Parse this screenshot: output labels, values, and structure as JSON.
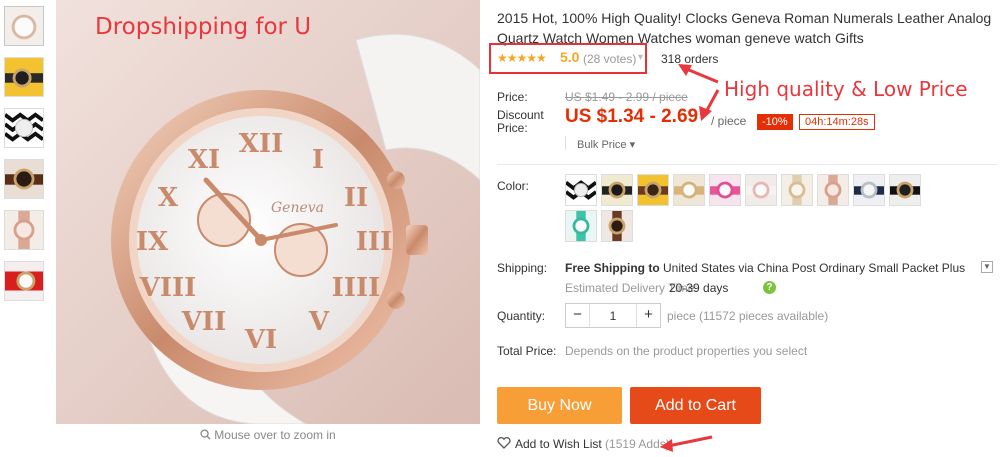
{
  "overlay": {
    "dropshipping": "Dropshipping for U"
  },
  "zoom_hint": "Mouse over to zoom in",
  "product": {
    "title": "2015 Hot, 100% High Quality! Clocks Geneva Roman Numerals Leather Analog Quartz Watch Women Watches woman geneve watch Gifts",
    "stars": "★★★★★",
    "rating": "5.0",
    "votes": "(28 votes)",
    "orders": "318 orders"
  },
  "annotations": {
    "high_quality": "High quality & Low Price"
  },
  "price": {
    "price_label": "Price:",
    "original": "US $1.49 - 2.99 / piece",
    "discount_label_1": "Discount",
    "discount_label_2": "Price:",
    "discount_price": "US $1.34 - 2.69",
    "per_piece": "/ piece",
    "badge": "-10%",
    "countdown": "04h:14m:28s",
    "bulk": "Bulk Price ▾"
  },
  "color": {
    "label": "Color:",
    "swatches": [
      "chevron-black-white",
      "black-gold",
      "brown-gold",
      "gold-white",
      "pink",
      "pink-white",
      "beige",
      "rose-gold",
      "navy",
      "black",
      "teal",
      "brown"
    ]
  },
  "shipping": {
    "label": "Shipping:",
    "free": "Free Shipping to",
    "dest": " United States via China Post Ordinary Small Packet Plus",
    "est_label": "Estimated Delivery Time:",
    "est_days": "20-39 days",
    "help": "?"
  },
  "quantity": {
    "label": "Quantity:",
    "value": "1",
    "minus": "−",
    "plus": "+",
    "note": "piece (11572 pieces available)"
  },
  "total": {
    "label": "Total Price:",
    "note": "Depends on the product properties you select"
  },
  "actions": {
    "buy_now": "Buy Now",
    "add_to_cart": "Add to Cart",
    "wish": "Add to Wish List",
    "wish_count": "(1519 Adds)"
  },
  "colors": {
    "accent_red": "#e62e04",
    "star": "#f5a623",
    "buy": "#f89e36",
    "cart": "#e64a19",
    "annot_red": "#e8383d"
  }
}
